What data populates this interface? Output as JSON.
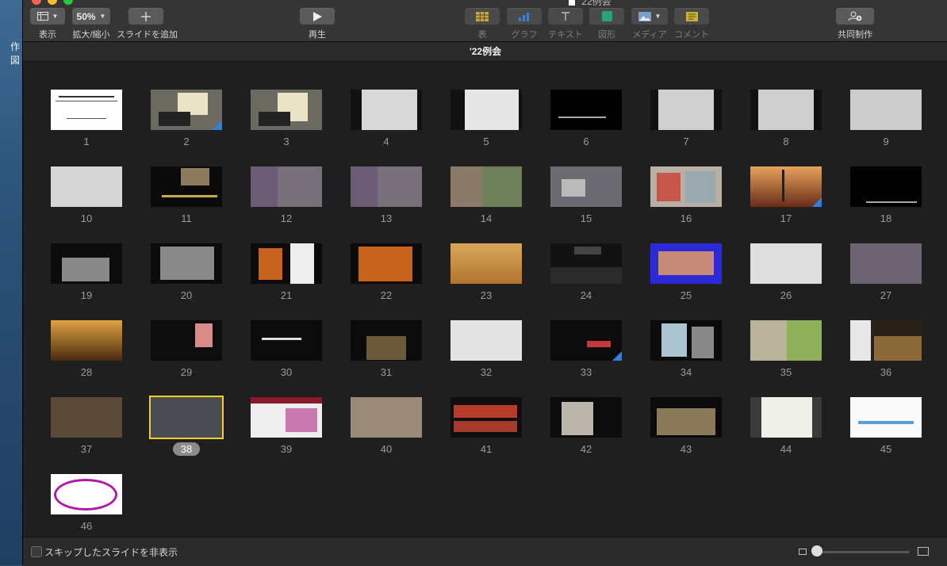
{
  "desktop": {
    "label": "作図"
  },
  "window": {
    "title": "'22例会"
  },
  "toolbar": {
    "view": {
      "label": "表示"
    },
    "zoom": {
      "value": "50%",
      "label": "拡大/縮小"
    },
    "add_slide": {
      "label": "スライドを追加"
    },
    "play": {
      "label": "再生"
    },
    "table": {
      "label": "表"
    },
    "chart": {
      "label": "グラフ"
    },
    "text": {
      "label": "テキスト"
    },
    "shape": {
      "label": "図形"
    },
    "media": {
      "label": "メディア"
    },
    "comment": {
      "label": "コメント"
    },
    "collaborate": {
      "label": "共同制作"
    }
  },
  "document": {
    "title": "'22例会"
  },
  "slides": [
    {
      "n": "1"
    },
    {
      "n": "2"
    },
    {
      "n": "3"
    },
    {
      "n": "4"
    },
    {
      "n": "5"
    },
    {
      "n": "6"
    },
    {
      "n": "7"
    },
    {
      "n": "8"
    },
    {
      "n": "9"
    },
    {
      "n": "10"
    },
    {
      "n": "11"
    },
    {
      "n": "12"
    },
    {
      "n": "13"
    },
    {
      "n": "14"
    },
    {
      "n": "15"
    },
    {
      "n": "16"
    },
    {
      "n": "17"
    },
    {
      "n": "18"
    },
    {
      "n": "19"
    },
    {
      "n": "20"
    },
    {
      "n": "21"
    },
    {
      "n": "22"
    },
    {
      "n": "23"
    },
    {
      "n": "24"
    },
    {
      "n": "25"
    },
    {
      "n": "26"
    },
    {
      "n": "27"
    },
    {
      "n": "28"
    },
    {
      "n": "29"
    },
    {
      "n": "30"
    },
    {
      "n": "31"
    },
    {
      "n": "32"
    },
    {
      "n": "33"
    },
    {
      "n": "34"
    },
    {
      "n": "35"
    },
    {
      "n": "36"
    },
    {
      "n": "37"
    },
    {
      "n": "38"
    },
    {
      "n": "39"
    },
    {
      "n": "40"
    },
    {
      "n": "41"
    },
    {
      "n": "42"
    },
    {
      "n": "43"
    },
    {
      "n": "44"
    },
    {
      "n": "45"
    },
    {
      "n": "46"
    }
  ],
  "selected_slide": "38",
  "bottom": {
    "hide_skipped_label": "スキップしたスライドを非表示"
  },
  "colors": {
    "accent_selected": "#f4d21c",
    "skip_marker": "#2f7fe6"
  }
}
